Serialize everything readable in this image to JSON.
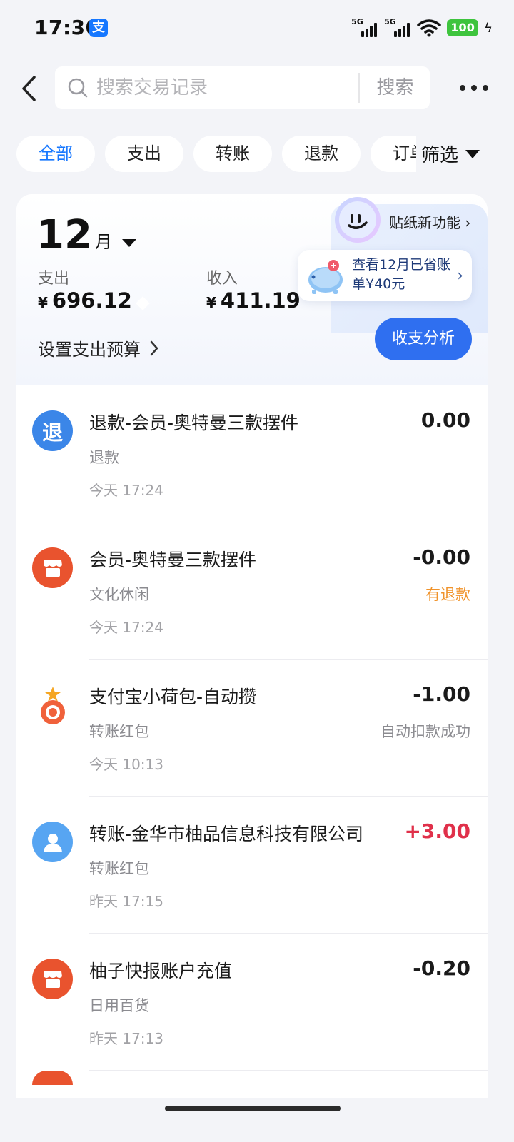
{
  "status_bar": {
    "time": "17:30",
    "app_badge": "支",
    "signal_1": "5G",
    "signal_2": "5G",
    "battery": "100"
  },
  "header": {
    "search_placeholder": "搜索交易记录",
    "search_button": "搜索"
  },
  "filters": {
    "chips": [
      "全部",
      "支出",
      "转账",
      "退款",
      "订单"
    ],
    "active_index": 0,
    "filter_label": "筛选"
  },
  "summary": {
    "month": "12",
    "month_unit": "月",
    "expense_label": "支出",
    "expense_currency": "¥",
    "expense_amount": "696.12",
    "income_label": "收入",
    "income_currency": "¥",
    "income_amount": "411.19",
    "budget_label": "设置支出预算",
    "sticker_label": "贴纸新功能",
    "savings_text": "查看12月已省账单¥40元",
    "analysis_button": "收支分析"
  },
  "transactions": [
    {
      "icon": "refund-icon",
      "icon_text": "退",
      "icon_color": "#3b86e8",
      "title": "退款-会员-奥特曼三款摆件",
      "category": "退款",
      "time": "今天 17:24",
      "amount": "0.00",
      "note": ""
    },
    {
      "icon": "shop-icon",
      "icon_color": "#e9532e",
      "title": "会员-奥特曼三款摆件",
      "category": "文化休闲",
      "time": "今天 17:24",
      "amount": "-0.00",
      "note": "有退款",
      "note_color": "#f0932b"
    },
    {
      "icon": "pocket-icon",
      "icon_color": "#f0613b",
      "title": "支付宝小荷包-自动攒",
      "category": "转账红包",
      "time": "今天 10:13",
      "amount": "-1.00",
      "note": "自动扣款成功"
    },
    {
      "icon": "person-icon",
      "icon_color": "#57a5f2",
      "title": "转账-金华市柚品信息科技有限公司",
      "category": "转账红包",
      "time": "昨天 17:15",
      "amount": "+3.00",
      "note": "",
      "amount_color": "#e0304a"
    },
    {
      "icon": "shop-icon",
      "icon_color": "#e9532e",
      "title": "柚子快报账户充值",
      "category": "日用百货",
      "time": "昨天 17:13",
      "amount": "-0.20",
      "note": ""
    }
  ]
}
